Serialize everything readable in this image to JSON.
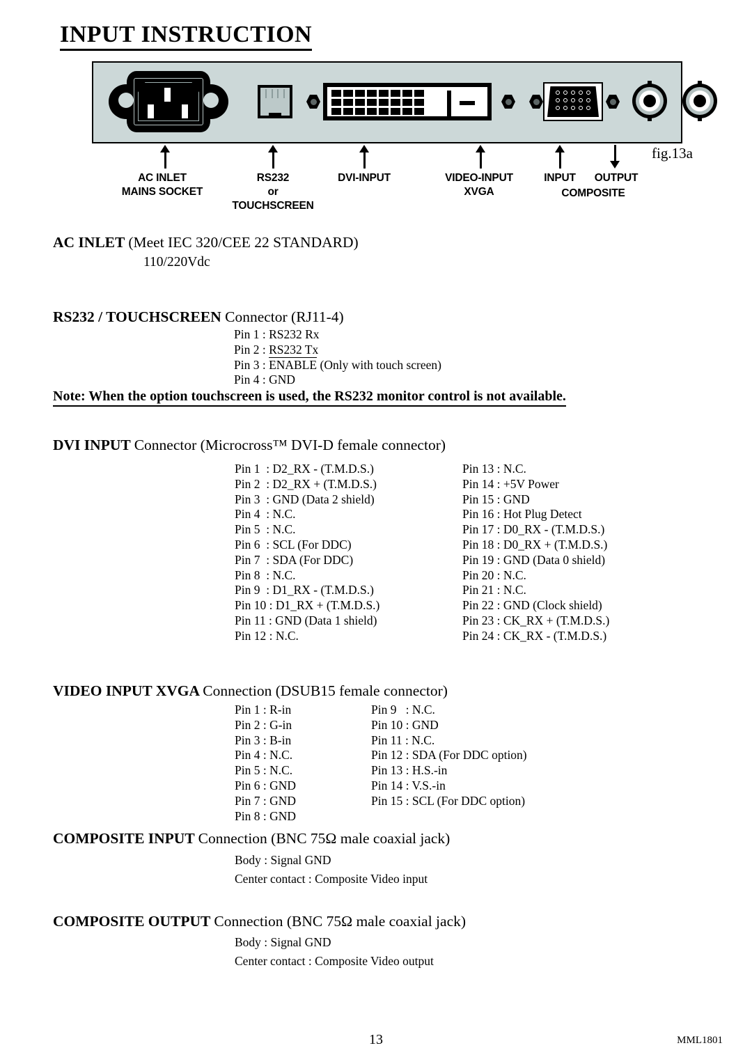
{
  "document": {
    "title": "INPUT INSTRUCTION",
    "figure_label": "fig.13a",
    "page_number": "13",
    "doc_code": "MML1801"
  },
  "figure": {
    "name": "rear-connector-panel",
    "panel_color": "#ccd8d8",
    "callouts": [
      {
        "id": "ac-inlet",
        "lines": [
          "AC INLET",
          "MAINS SOCKET"
        ],
        "arrow": "up"
      },
      {
        "id": "rs232",
        "lines": [
          "RS232",
          "or",
          "TOUCHSCREEN"
        ],
        "arrow": "up"
      },
      {
        "id": "dvi-input",
        "lines": [
          "DVI-INPUT"
        ],
        "arrow": "up"
      },
      {
        "id": "video-input",
        "lines": [
          "VIDEO-INPUT",
          "XVGA"
        ],
        "arrow": "up"
      },
      {
        "id": "composite-input",
        "lines": [
          "INPUT"
        ],
        "arrow": "up"
      },
      {
        "id": "composite-output",
        "lines": [
          "OUTPUT"
        ],
        "arrow": "down"
      },
      {
        "id": "composite",
        "lines": [
          "COMPOSITE"
        ],
        "arrow": "none"
      }
    ]
  },
  "sections": {
    "ac_inlet": {
      "heading_bold": "AC INLET ",
      "heading_rest": "(Meet IEC 320/CEE 22 STANDARD)",
      "value": "110/220Vdc"
    },
    "rs232": {
      "heading_bold": "RS232 / TOUCHSCREEN ",
      "heading_rest": "Connector (RJ11-4)",
      "pins": [
        {
          "label": "Pin 1 : ",
          "value": "RS232 Rx"
        },
        {
          "label": "Pin 2 : ",
          "value": "RS232 Tx"
        },
        {
          "label": "Pin 3 : ",
          "overline": "ENABLE",
          "value": " (Only with touch screen)"
        },
        {
          "label": "Pin 4 : ",
          "value": "GND"
        }
      ],
      "note": "Note: When the option touchscreen is used, the RS232 monitor control is not available."
    },
    "dvi": {
      "heading_bold": "DVI INPUT ",
      "heading_rest": "Connector (Microcross™ DVI-D female connector)",
      "left_column": [
        "Pin 1  : D2_RX - (T.M.D.S.)",
        "Pin 2  : D2_RX + (T.M.D.S.)",
        "Pin 3  : GND (Data 2 shield)",
        "Pin 4  : N.C.",
        "Pin 5  : N.C.",
        "Pin 6  : SCL (For DDC)",
        "Pin 7  : SDA (For DDC)",
        "Pin 8  : N.C.",
        "Pin 9  : D1_RX - (T.M.D.S.)",
        "Pin 10 : D1_RX + (T.M.D.S.)",
        "Pin 11 : GND (Data 1 shield)",
        "Pin 12 : N.C."
      ],
      "right_column": [
        "Pin 13 : N.C.",
        "Pin 14 : +5V Power",
        "Pin 15 : GND",
        "Pin 16 : Hot Plug Detect",
        "Pin 17 : D0_RX - (T.M.D.S.)",
        "Pin 18 : D0_RX + (T.M.D.S.)",
        "Pin 19 : GND (Data 0 shield)",
        "Pin 20 : N.C.",
        "Pin 21 : N.C.",
        "Pin 22 : GND (Clock shield)",
        "Pin 23 : CK_RX + (T.M.D.S.)",
        "Pin 24 : CK_RX - (T.M.D.S.)"
      ]
    },
    "xvga": {
      "heading_bold": "VIDEO INPUT XVGA ",
      "heading_rest": "Connection (DSUB15 female connector)",
      "left_column": [
        "Pin 1 : R-in",
        "Pin 2 : G-in",
        "Pin 3 : B-in",
        "Pin 4 : N.C.",
        "Pin 5 : N.C.",
        "Pin 6 : GND",
        "Pin 7 : GND",
        "Pin 8 : GND"
      ],
      "right_column": [
        "Pin 9   : N.C.",
        "Pin 10 : GND",
        "Pin 11 : N.C.",
        "Pin 12 : SDA (For DDC option)",
        "Pin 13 : H.S.-in",
        "Pin 14 : V.S.-in",
        "Pin 15 : SCL (For DDC option)"
      ]
    },
    "composite_input": {
      "heading_bold": "COMPOSITE INPUT ",
      "heading_rest": "Connection (BNC 75Ω male coaxial jack)",
      "lines": [
        "Body : Signal GND",
        "Center contact : Composite Video input"
      ]
    },
    "composite_output": {
      "heading_bold": "COMPOSITE OUTPUT ",
      "heading_rest": "Connection (BNC 75Ω male coaxial jack)",
      "lines": [
        "Body : Signal GND",
        "Center contact : Composite Video output"
      ]
    }
  }
}
